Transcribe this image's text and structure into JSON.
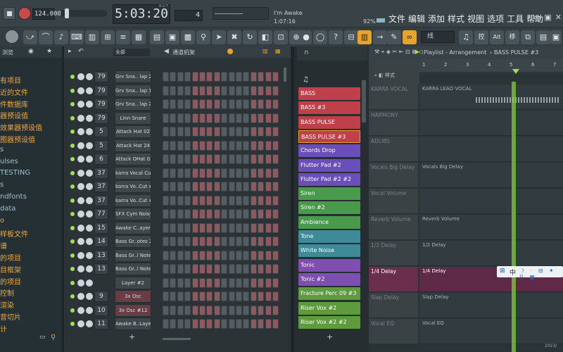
{
  "transport": {
    "tempo": "124.000",
    "time": "5:03:20",
    "time_label": "B:S:T",
    "pattern_num": "4",
    "hint_title": "I'm Awake",
    "hint_time": "1:07:16",
    "cpu": "92%"
  },
  "menu": [
    "文件",
    "编辑",
    "添加",
    "样式",
    "视图",
    "选项",
    "工具",
    "帮助"
  ],
  "snap": "线",
  "browser": {
    "title": "浏览",
    "items": [
      "有项目",
      "近的文件",
      "件数据库",
      "器预设值",
      "效果器预设值",
      "图器预设值",
      "s",
      "ulses",
      "TESTING",
      "s",
      "ndfonts",
      "data",
      "o",
      "样板文件",
      "谱",
      "的项目",
      "目框架",
      "的项目",
      "控制",
      "渲染",
      "音切片",
      "计"
    ]
  },
  "rack": {
    "title": "通道机架",
    "group": "全部",
    "channels": [
      {
        "num": "79",
        "name": "Grv Sna.. lap 28",
        "red": false
      },
      {
        "num": "79",
        "name": "Grv Sna.. lap 13",
        "red": false
      },
      {
        "num": "79",
        "name": "Grv Sna.. lap 21",
        "red": false
      },
      {
        "num": "79",
        "name": "Linn Snare",
        "red": false
      },
      {
        "num": "5",
        "name": "Attack Hat 02",
        "red": false
      },
      {
        "num": "5",
        "name": "Attack Hat 24",
        "red": false
      },
      {
        "num": "6",
        "name": "Attack OHat 02",
        "red": false
      },
      {
        "num": "37",
        "name": "karra Vocal Cut",
        "red": false
      },
      {
        "num": "37",
        "name": "karra Vo..Cut #2",
        "red": false
      },
      {
        "num": "37",
        "name": "karra Vo..Cut #3",
        "red": false
      },
      {
        "num": "77",
        "name": "SFX Cym Noisy",
        "red": false
      },
      {
        "num": "15",
        "name": "Awake C..ayer 2",
        "red": false
      },
      {
        "num": "14",
        "name": "Bass Gr..otes 2",
        "red": false
      },
      {
        "num": "13",
        "name": "Bass Gr..l Notes",
        "red": false
      },
      {
        "num": "13",
        "name": "Bass Gr..l Notes",
        "red": false
      },
      {
        "num": "",
        "name": "Layer #2",
        "red": false
      },
      {
        "num": "9",
        "name": "3x Osc",
        "red": true
      },
      {
        "num": "10",
        "name": "3x Osc #12",
        "red": true
      },
      {
        "num": "11",
        "name": "Awake B..Layer",
        "red": false
      }
    ]
  },
  "patterns": [
    {
      "name": "BASS",
      "color": "#c0404a"
    },
    {
      "name": "BASS #3",
      "color": "#c0404a"
    },
    {
      "name": "BASS PULSE",
      "color": "#c0404a"
    },
    {
      "name": "BASS PULSE #3",
      "color": "#c0404a"
    },
    {
      "name": "Chords  Drop",
      "color": "#6a4fb8"
    },
    {
      "name": "Flutter Pad #2",
      "color": "#6a4fb8"
    },
    {
      "name": "Flutter Pad #2 #2",
      "color": "#6a4fb8"
    },
    {
      "name": "Siren",
      "color": "#4a9a4e"
    },
    {
      "name": "Siren #2",
      "color": "#4a9a4e"
    },
    {
      "name": "Ambience",
      "color": "#4a9a4e"
    },
    {
      "name": "Tone",
      "color": "#3e8a98"
    },
    {
      "name": "White Noise",
      "color": "#3e8a98"
    },
    {
      "name": "Tonic",
      "color": "#7e4fb0"
    },
    {
      "name": "Tonic #2",
      "color": "#7e4fb0"
    },
    {
      "name": "Fracture Perc 09 #3",
      "color": "#5e9a3e"
    },
    {
      "name": "Riser Vox #2",
      "color": "#5e9a3e"
    },
    {
      "name": "Riser Vox #2 #2",
      "color": "#5e9a3e"
    }
  ],
  "playlist": {
    "title": "Playlist - Arrangement",
    "pattern": "BASS PULSE #3",
    "ruler": [
      "1",
      "2",
      "3",
      "4",
      "5",
      "6",
      "7"
    ],
    "tracks": [
      {
        "label": "KARRA VOCAL",
        "clip": "KARRA LEAD VOCAL"
      },
      {
        "label": "HARMONY",
        "clip": ""
      },
      {
        "label": "ADLIBS",
        "clip": ""
      },
      {
        "label": "Vocals Big Delay",
        "clip": "Vocals Big Delay"
      },
      {
        "label": "Vocal Volume",
        "clip": ""
      },
      {
        "label": "Reverb Volume",
        "clip": "Reverb Volume"
      },
      {
        "label": "1/2 Delay",
        "clip": "1/2 Delay"
      },
      {
        "label": "1/4 Delay",
        "clip": "1/4 Delay"
      },
      {
        "label": "Slap Delay",
        "clip": "Slap Delay"
      },
      {
        "label": "Vocal EQ",
        "clip": "Vocal EQ"
      }
    ]
  },
  "ime": {
    "lang": "中"
  },
  "clock": "2023/"
}
